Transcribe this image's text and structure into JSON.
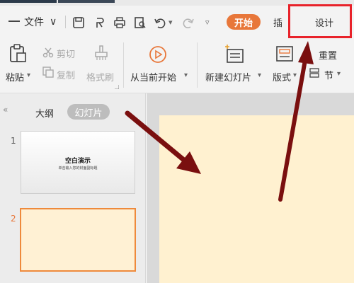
{
  "menu": {
    "file_label": "文件",
    "start_tab": "开始",
    "insert_tab": "插",
    "design_tab": "设计"
  },
  "ribbon": {
    "paste_label": "粘贴",
    "cut_label": "剪切",
    "copy_label": "复制",
    "format_painter_label": "格式刷",
    "from_current_label": "从当前开始",
    "new_slide_label": "新建幻灯片",
    "layout_label": "版式",
    "reset_label": "重置",
    "section_label": "节"
  },
  "panel": {
    "outline_tab": "大纲",
    "slides_tab": "幻灯片",
    "slide1_number": "1",
    "slide2_number": "2",
    "slide1_title": "空白演示",
    "slide1_subtitle": "单击输入您的封面副标题"
  },
  "colors": {
    "accent_orange": "#e8773a",
    "highlight_red": "#e8222a",
    "arrow_dark_red": "#7a0f0f",
    "slide_fill": "#fff1d0"
  }
}
